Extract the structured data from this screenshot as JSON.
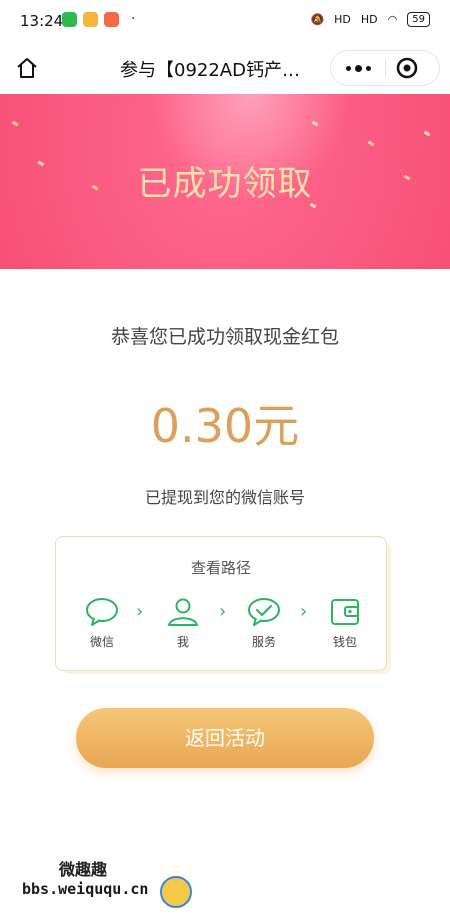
{
  "status_bar": {
    "time": "13:24",
    "signal_1": "HD",
    "signal_2": "HD",
    "battery": "59"
  },
  "navbar": {
    "title": "参与【0922AD钙产…"
  },
  "banner": {
    "title": "已成功领取"
  },
  "result": {
    "congrats": "恭喜您已成功领取现金红包",
    "amount": "0.30元",
    "notice": "已提现到您的微信账号"
  },
  "path_card": {
    "title": "查看路径",
    "steps": [
      {
        "label": "微信",
        "icon": "chat-bubble-icon"
      },
      {
        "label": "我",
        "icon": "person-icon"
      },
      {
        "label": "服务",
        "icon": "check-circle-icon"
      },
      {
        "label": "钱包",
        "icon": "wallet-icon"
      }
    ],
    "arrow": "›"
  },
  "actions": {
    "back_label": "返回活动"
  },
  "watermark": {
    "name": "微趣趣",
    "url": "bbs.weiququ.cn"
  },
  "colors": {
    "banner_pink": "#f04a72",
    "banner_title": "#ffe3a8",
    "amount_gold": "#d9a15c",
    "icon_green": "#2cb45f",
    "button_gold": "#eaae5d"
  }
}
